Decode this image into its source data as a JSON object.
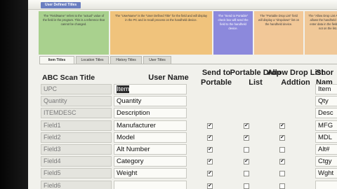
{
  "window": {
    "title": "User Defined Titles"
  },
  "notes": [
    {
      "text": "The \"FieldName\" refers to the \"actual\" value of the field in the program. This is a reference that cannot be changed."
    },
    {
      "text": "The \"UserName\" is the \"User Defined Title\" for the field and will display in the PC and in recall process on the handheld device."
    },
    {
      "text": "The \"Send to Portable\" check box will send the field to the handheld device."
    },
    {
      "text": "The \"Portable Drop List\" field will display a \"dropdown\" list on the handheld device."
    },
    {
      "text": "The \"Allow Drop List Addition\" allows the handheld user to enter data in the field that is not on the list."
    },
    {
      "text": ""
    }
  ],
  "tabs": [
    "Item Titles",
    "Location Titles",
    "History Titles",
    "User Titles"
  ],
  "headers": {
    "abc": "ABC Scan Title",
    "user": "User Name",
    "send": "Send to Portable",
    "drop": "Portable Drop List",
    "allow": "Allow Drop List Addtion",
    "short": "Shor Nam"
  },
  "rows": [
    {
      "abc": "UPC",
      "user": "Item",
      "send": false,
      "drop": false,
      "allow": false,
      "short": "Item"
    },
    {
      "abc": "Quantity",
      "user": "Quantity",
      "send": false,
      "drop": false,
      "allow": false,
      "short": "Qty"
    },
    {
      "abc": "ITEMDESC",
      "user": "Description",
      "send": false,
      "drop": false,
      "allow": false,
      "short": "Desc"
    },
    {
      "abc": "Field1",
      "user": "Manufacturer",
      "send": true,
      "drop": true,
      "allow": true,
      "short": "MFG"
    },
    {
      "abc": "Field2",
      "user": "Model",
      "send": true,
      "drop": true,
      "allow": true,
      "short": "MDL"
    },
    {
      "abc": "Field3",
      "user": "Alt Number",
      "send": true,
      "drop": false,
      "allow": false,
      "short": "Alt#"
    },
    {
      "abc": "Field4",
      "user": "Category",
      "send": true,
      "drop": true,
      "allow": true,
      "short": "Ctgy"
    },
    {
      "abc": "Field5",
      "user": "Weight",
      "send": true,
      "drop": false,
      "allow": false,
      "short": "Wght"
    },
    {
      "abc": "Field6",
      "user": "",
      "send": true,
      "drop": false,
      "allow": false,
      "short": ""
    }
  ]
}
